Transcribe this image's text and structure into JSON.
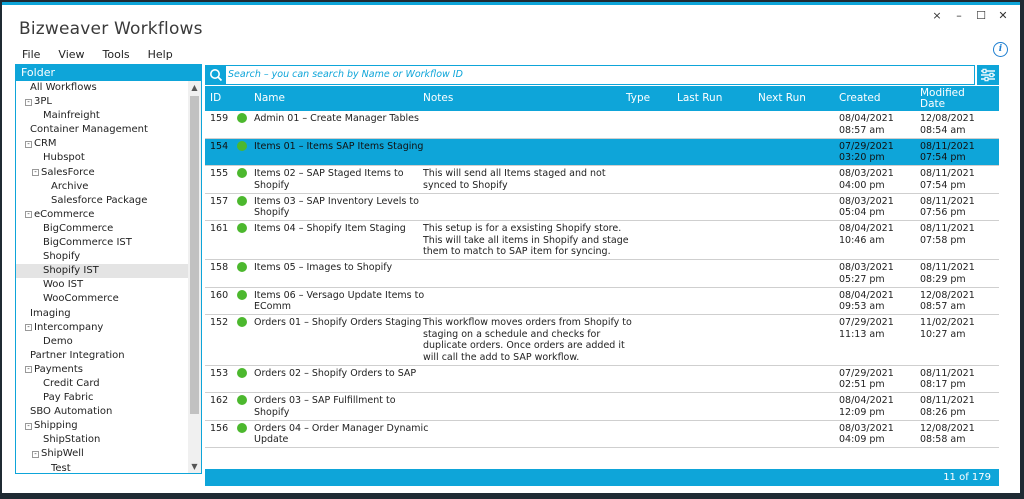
{
  "app": {
    "title": "Bizweaver Workflows"
  },
  "window_controls": [
    "×",
    "–",
    "☐",
    "✕"
  ],
  "menu": [
    "File",
    "View",
    "Tools",
    "Help"
  ],
  "folder": {
    "header": "Folder",
    "items": [
      {
        "label": "All Workflows",
        "level": 0,
        "expander": ""
      },
      {
        "label": "3PL",
        "level": 0,
        "expander": "-"
      },
      {
        "label": "Mainfreight",
        "level": 1,
        "expander": ""
      },
      {
        "label": "Container Management",
        "level": 0,
        "expander": ""
      },
      {
        "label": "CRM",
        "level": 0,
        "expander": "-"
      },
      {
        "label": "Hubspot",
        "level": 1,
        "expander": ""
      },
      {
        "label": "SalesForce",
        "level": 1,
        "expander": "-"
      },
      {
        "label": "Archive",
        "level": 2,
        "expander": ""
      },
      {
        "label": "Salesforce Package",
        "level": 2,
        "expander": ""
      },
      {
        "label": "eCommerce",
        "level": 0,
        "expander": "-"
      },
      {
        "label": "BigCommerce",
        "level": 1,
        "expander": ""
      },
      {
        "label": "BigCommerce IST",
        "level": 1,
        "expander": ""
      },
      {
        "label": "Shopify",
        "level": 1,
        "expander": ""
      },
      {
        "label": "Shopify IST",
        "level": 1,
        "expander": "",
        "selected": true
      },
      {
        "label": "Woo IST",
        "level": 1,
        "expander": ""
      },
      {
        "label": "WooCommerce",
        "level": 1,
        "expander": ""
      },
      {
        "label": "Imaging",
        "level": 0,
        "expander": ""
      },
      {
        "label": "Intercompany",
        "level": 0,
        "expander": "-"
      },
      {
        "label": "Demo",
        "level": 1,
        "expander": ""
      },
      {
        "label": "Partner Integration",
        "level": 0,
        "expander": ""
      },
      {
        "label": "Payments",
        "level": 0,
        "expander": "-"
      },
      {
        "label": "Credit Card",
        "level": 1,
        "expander": ""
      },
      {
        "label": "Pay Fabric",
        "level": 1,
        "expander": ""
      },
      {
        "label": "SBO Automation",
        "level": 0,
        "expander": ""
      },
      {
        "label": "Shipping",
        "level": 0,
        "expander": "-"
      },
      {
        "label": "ShipStation",
        "level": 1,
        "expander": ""
      },
      {
        "label": "ShipWell",
        "level": 1,
        "expander": "-"
      },
      {
        "label": "Test",
        "level": 2,
        "expander": ""
      }
    ]
  },
  "search": {
    "placeholder": "Search – you can search by Name or Workflow ID",
    "value": ""
  },
  "grid": {
    "columns": [
      "ID",
      "Name",
      "Notes",
      "Type",
      "Last Run",
      "Next Run",
      "Created",
      "Modified Date"
    ],
    "rows": [
      {
        "id": "159",
        "name": [
          "Admin  01 – Create  Manager Tables"
        ],
        "notes": [],
        "created": [
          "08/04/2021",
          "08:57 am"
        ],
        "modified": [
          "12/08/2021",
          "08:54 am"
        ],
        "selected": false
      },
      {
        "id": "154",
        "name": [
          "Items 01 –  Items SAP Items Staging"
        ],
        "notes": [],
        "created": [
          "07/29/2021",
          "03:20 pm"
        ],
        "modified": [
          "08/11/2021",
          "07:54 pm"
        ],
        "selected": true
      },
      {
        "id": "155",
        "name": [
          "Items 02 – SAP Staged Items to",
          "Shopify"
        ],
        "notes": [
          "This will send all Items staged and not",
          "synced to Shopify"
        ],
        "created": [
          "08/03/2021",
          "04:00 pm"
        ],
        "modified": [
          "08/11/2021",
          "07:54 pm"
        ],
        "selected": false
      },
      {
        "id": "157",
        "name": [
          "Items 03 –  SAP Inventory Levels to",
          "Shopify"
        ],
        "notes": [],
        "created": [
          "08/03/2021",
          "05:04 pm"
        ],
        "modified": [
          "08/11/2021",
          "07:56 pm"
        ],
        "selected": false
      },
      {
        "id": "161",
        "name": [
          "Items 04 – Shopify Item Staging"
        ],
        "notes": [
          "This setup is for a exsisting Shopify store.",
          "This will take all items in Shopify and stage",
          "them to match to SAP item for syncing."
        ],
        "created": [
          "08/04/2021",
          "10:46 am"
        ],
        "modified": [
          "08/11/2021",
          "07:58 pm"
        ],
        "selected": false
      },
      {
        "id": "158",
        "name": [
          "Items 05 – Images to Shopify"
        ],
        "notes": [],
        "created": [
          "08/03/2021",
          "05:27 pm"
        ],
        "modified": [
          "08/11/2021",
          "08:29 pm"
        ],
        "selected": false
      },
      {
        "id": "160",
        "name": [
          "Items 06 – Versago Update Items to",
          "EComm"
        ],
        "notes": [],
        "created": [
          "08/04/2021",
          "09:53 am"
        ],
        "modified": [
          "12/08/2021",
          "08:57 am"
        ],
        "selected": false
      },
      {
        "id": "152",
        "name": [
          "Orders 01 – Shopify Orders Staging"
        ],
        "notes": [
          "This workflow moves orders from Shopify to",
          "staging on a schedule and checks for",
          "duplicate orders. Once orders are added it",
          "will call the add to SAP workflow."
        ],
        "created": [
          "07/29/2021",
          "11:13 am"
        ],
        "modified": [
          "11/02/2021",
          "10:27 am"
        ],
        "selected": false
      },
      {
        "id": "153",
        "name": [
          "Orders 02 – Shopify Orders to SAP"
        ],
        "notes": [],
        "created": [
          "07/29/2021",
          "02:51 pm"
        ],
        "modified": [
          "08/11/2021",
          "08:17 pm"
        ],
        "selected": false
      },
      {
        "id": "162",
        "name": [
          "Orders 03 – SAP Fulfillment to",
          "Shopify"
        ],
        "notes": [],
        "created": [
          "08/04/2021",
          "12:09 pm"
        ],
        "modified": [
          "08/11/2021",
          "08:26 pm"
        ],
        "selected": false
      },
      {
        "id": "156",
        "name": [
          "Orders 04 – Order Manager Dynamic",
          "Update"
        ],
        "notes": [],
        "created": [
          "08/03/2021",
          "04:09 pm"
        ],
        "modified": [
          "12/08/2021",
          "08:58 am"
        ],
        "selected": false
      }
    ]
  },
  "footer": {
    "count": "11 of 179"
  },
  "colors": {
    "accent": "#0ea5d9",
    "status_ok": "#4cb82e"
  }
}
